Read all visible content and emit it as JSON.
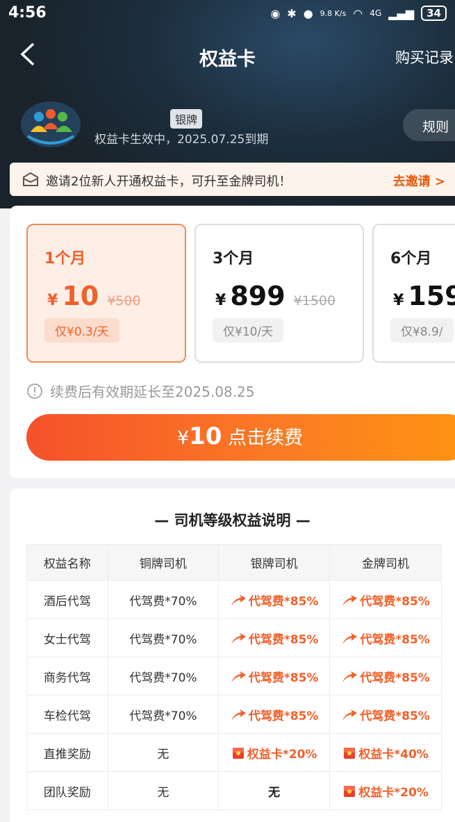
{
  "status_bar": {
    "time": "4:56",
    "net_speed": "9.8 K/s",
    "network": "4G",
    "battery": "34"
  },
  "nav": {
    "title": "权益卡",
    "purchase_record": "购买记录"
  },
  "member": {
    "badge": "银牌",
    "status_text": "权益卡生效中，2025.07.25到期",
    "rules_button": "规则"
  },
  "invite": {
    "text": "邀请2位新人开通权益卡，可升至金牌司机！",
    "action": "去邀请 >"
  },
  "plans": [
    {
      "duration": "1个月",
      "currency": "¥",
      "price": "10",
      "original_price": "¥500",
      "per_day": "仅¥0.3/天",
      "selected": true
    },
    {
      "duration": "3个月",
      "currency": "¥",
      "price": "899",
      "original_price": "¥1500",
      "per_day": "仅¥10/天",
      "selected": false
    },
    {
      "duration": "6个月",
      "currency": "¥",
      "price": "159",
      "original_price": "",
      "per_day": "仅¥8.9/",
      "selected": false
    }
  ],
  "renew_note": "续费后有效期延长至2025.08.25",
  "cta": {
    "currency": "¥",
    "amount": "10",
    "label": "点击续费"
  },
  "benefits": {
    "title": "— 司机等级权益说明 —",
    "headers": [
      "权益名称",
      "铜牌司机",
      "银牌司机",
      "金牌司机"
    ],
    "rows": [
      {
        "name": "酒后代驾",
        "bronze": "代驾费*70%",
        "silver": "代驾费*85%",
        "gold": "代驾费*85%"
      },
      {
        "name": "女士代驾",
        "bronze": "代驾费*70%",
        "silver": "代驾费*85%",
        "gold": "代驾费*85%"
      },
      {
        "name": "商务代驾",
        "bronze": "代驾费*70%",
        "silver": "代驾费*85%",
        "gold": "代驾费*85%"
      },
      {
        "name": "车检代驾",
        "bronze": "代驾费*70%",
        "silver": "代驾费*85%",
        "gold": "代驾费*85%"
      },
      {
        "name": "直推奖励",
        "bronze": "无",
        "silver": "权益卡*20%",
        "gold": "权益卡*40%"
      },
      {
        "name": "团队奖励",
        "bronze": "无",
        "silver": "无",
        "gold": "权益卡*20%"
      }
    ]
  },
  "colors": {
    "accent": "#f0602a",
    "hero_bg": "#1c2e3d"
  }
}
